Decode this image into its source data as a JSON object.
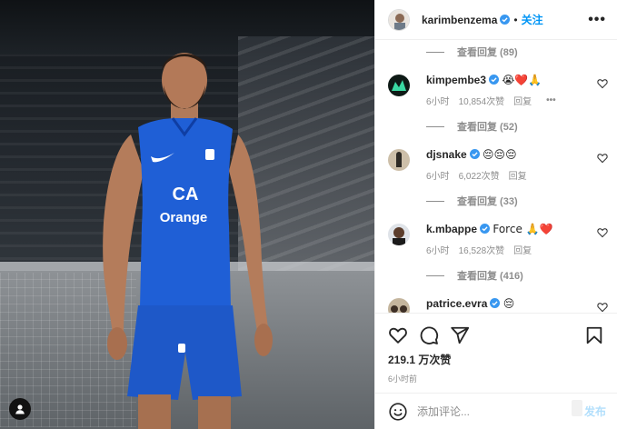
{
  "post": {
    "author": "karimbenzema",
    "follow_label": "关注",
    "separator": "•",
    "more_label": "•••"
  },
  "comments": {
    "top_view_replies": "查看回复 (89)",
    "items": [
      {
        "username": "kimpembe3",
        "text": "😭❤️🙏",
        "time": "6小时",
        "likes": "10,854次赞",
        "reply_label": "回复",
        "options": "•••",
        "view_replies": "查看回复 (52)"
      },
      {
        "username": "djsnake",
        "text": "😔😔😔",
        "time": "6小时",
        "likes": "6,022次赞",
        "reply_label": "回复",
        "view_replies": "查看回复 (33)"
      },
      {
        "username": "k.mbappe",
        "text": "Force 🙏❤️",
        "time": "6小时",
        "likes": "16,528次赞",
        "reply_label": "回复",
        "view_replies": "查看回复 (416)"
      },
      {
        "username": "patrice.evra",
        "text": "😔"
      }
    ]
  },
  "engagement": {
    "likes": "219.1 万次赞",
    "posted": "6小时前"
  },
  "composer": {
    "placeholder": "添加评论...",
    "post_label": "发布"
  },
  "photo": {
    "jersey_sponsor_logo": "CA",
    "jersey_sponsor": "Orange"
  },
  "colors": {
    "accent": "#0095f6",
    "accent_disabled": "#b2dffc",
    "verified": "#3897f0",
    "jersey": "#1f5fd6",
    "meta_text": "#8e8e8e"
  },
  "icons": {
    "like": "heart-icon",
    "comment": "comment-icon",
    "share": "paper-plane-icon",
    "save": "bookmark-icon",
    "emoji": "smiley-icon",
    "verified": "verified-badge-icon",
    "tags": "user-tag-icon"
  }
}
